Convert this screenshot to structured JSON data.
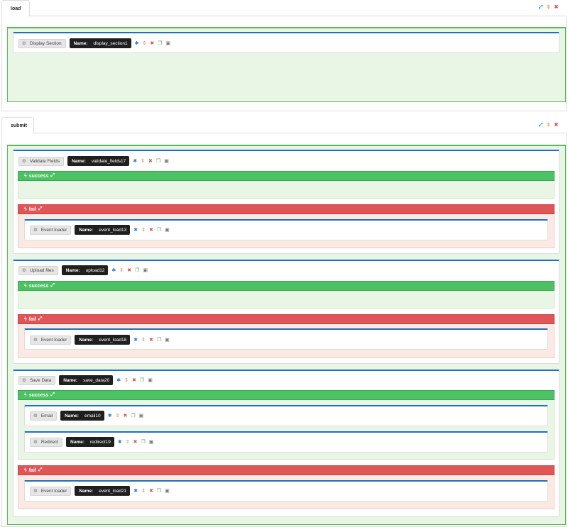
{
  "tabs": {
    "load": {
      "label": "load"
    },
    "submit": {
      "label": "submit"
    }
  },
  "controls": {
    "expand": "⤢",
    "move": "⇕",
    "close": "✖"
  },
  "labels": {
    "name": "Name:",
    "success": "success",
    "fail": "fail"
  },
  "load": {
    "display_section": {
      "type": "Display Section",
      "name": "display_section1"
    }
  },
  "submit": {
    "validate": {
      "type": "Validate Fields",
      "name": "validate_fields17",
      "fail_child": {
        "type": "Event loader",
        "name": "event_load13"
      }
    },
    "upload": {
      "type": "Upload files",
      "name": "upload12",
      "fail_child": {
        "type": "Event loader",
        "name": "event_load18"
      }
    },
    "save": {
      "type": "Save Data",
      "name": "save_data20",
      "success_children": [
        {
          "type": "Email",
          "name": "email10"
        },
        {
          "type": "Redirect",
          "name": "redirect19"
        }
      ],
      "fail_child": {
        "type": "Event loader",
        "name": "event_load21"
      }
    }
  },
  "colors": {
    "success": "#4cc264",
    "fail": "#e05555",
    "accent": "#1f6fbf",
    "zone": "#eaf6e5"
  }
}
